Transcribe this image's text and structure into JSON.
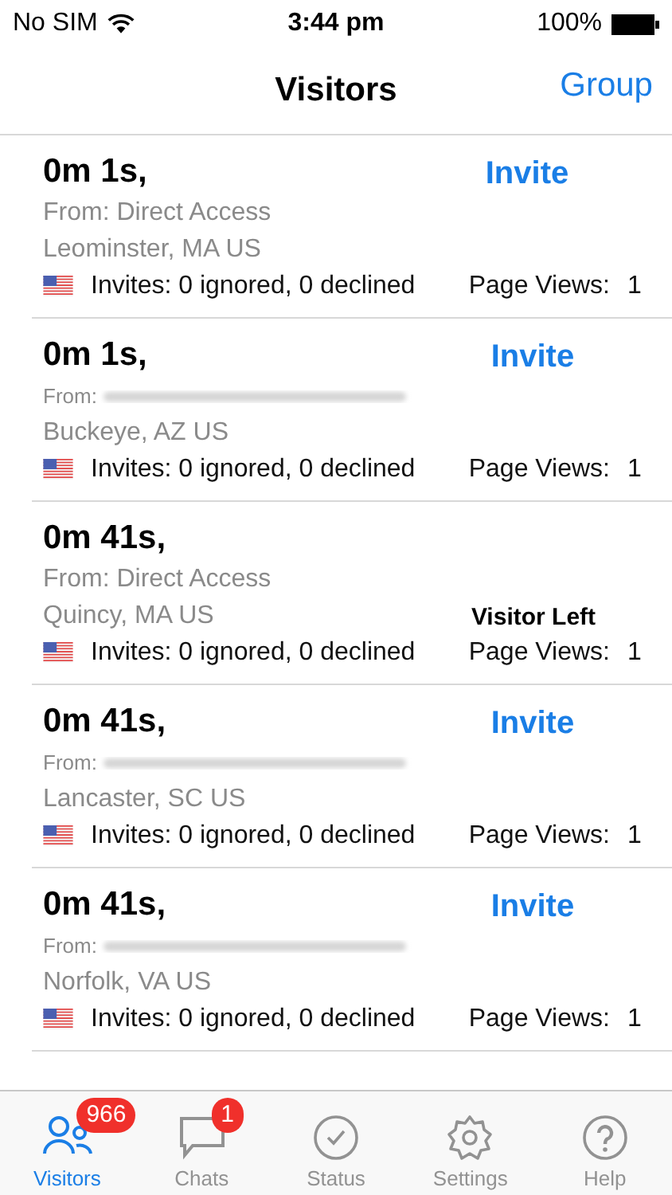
{
  "status_bar": {
    "carrier": "No SIM",
    "time": "3:44 pm",
    "battery": "100%"
  },
  "nav": {
    "title": "Visitors",
    "action": "Group"
  },
  "visitors": [
    {
      "duration": "0m 1s,",
      "from": {
        "kind": "text",
        "text": "From: Direct Access"
      },
      "location": "Leominster, MA US",
      "invites": "Invites: 0 ignored, 0 declined",
      "page_views_label": "Page Views:",
      "page_views": "1",
      "action": {
        "kind": "button",
        "text": "Invite"
      }
    },
    {
      "duration": "0m 1s,",
      "from": {
        "kind": "redacted",
        "text": "From:"
      },
      "location": "Buckeye, AZ US",
      "invites": "Invites: 0 ignored, 0 declined",
      "page_views_label": "Page Views:",
      "page_views": "1",
      "action": {
        "kind": "button",
        "text": "Invite"
      }
    },
    {
      "duration": "0m 41s,",
      "from": {
        "kind": "text",
        "text": "From: Direct Access"
      },
      "location": "Quincy, MA US",
      "invites": "Invites: 0 ignored, 0 declined",
      "page_views_label": "Page Views:",
      "page_views": "1",
      "action": {
        "kind": "status",
        "text": "Visitor Left"
      }
    },
    {
      "duration": "0m 41s,",
      "from": {
        "kind": "redacted",
        "text": "From:"
      },
      "location": "Lancaster, SC US",
      "invites": "Invites: 0 ignored, 0 declined",
      "page_views_label": "Page Views:",
      "page_views": "1",
      "action": {
        "kind": "button",
        "text": "Invite"
      }
    },
    {
      "duration": "0m 41s,",
      "from": {
        "kind": "redacted",
        "text": "From:"
      },
      "location": "Norfolk, VA US",
      "invites": "Invites: 0 ignored, 0 declined",
      "page_views_label": "Page Views:",
      "page_views": "1",
      "action": {
        "kind": "button",
        "text": "Invite"
      }
    }
  ],
  "tabs": [
    {
      "label": "Visitors",
      "kind": "people",
      "selected": true,
      "badge": "966"
    },
    {
      "label": "Chats",
      "kind": "chat",
      "selected": false,
      "badge": "1"
    },
    {
      "label": "Status",
      "kind": "check",
      "selected": false
    },
    {
      "label": "Settings",
      "kind": "gear",
      "selected": false
    },
    {
      "label": "Help",
      "kind": "help",
      "selected": false
    }
  ]
}
